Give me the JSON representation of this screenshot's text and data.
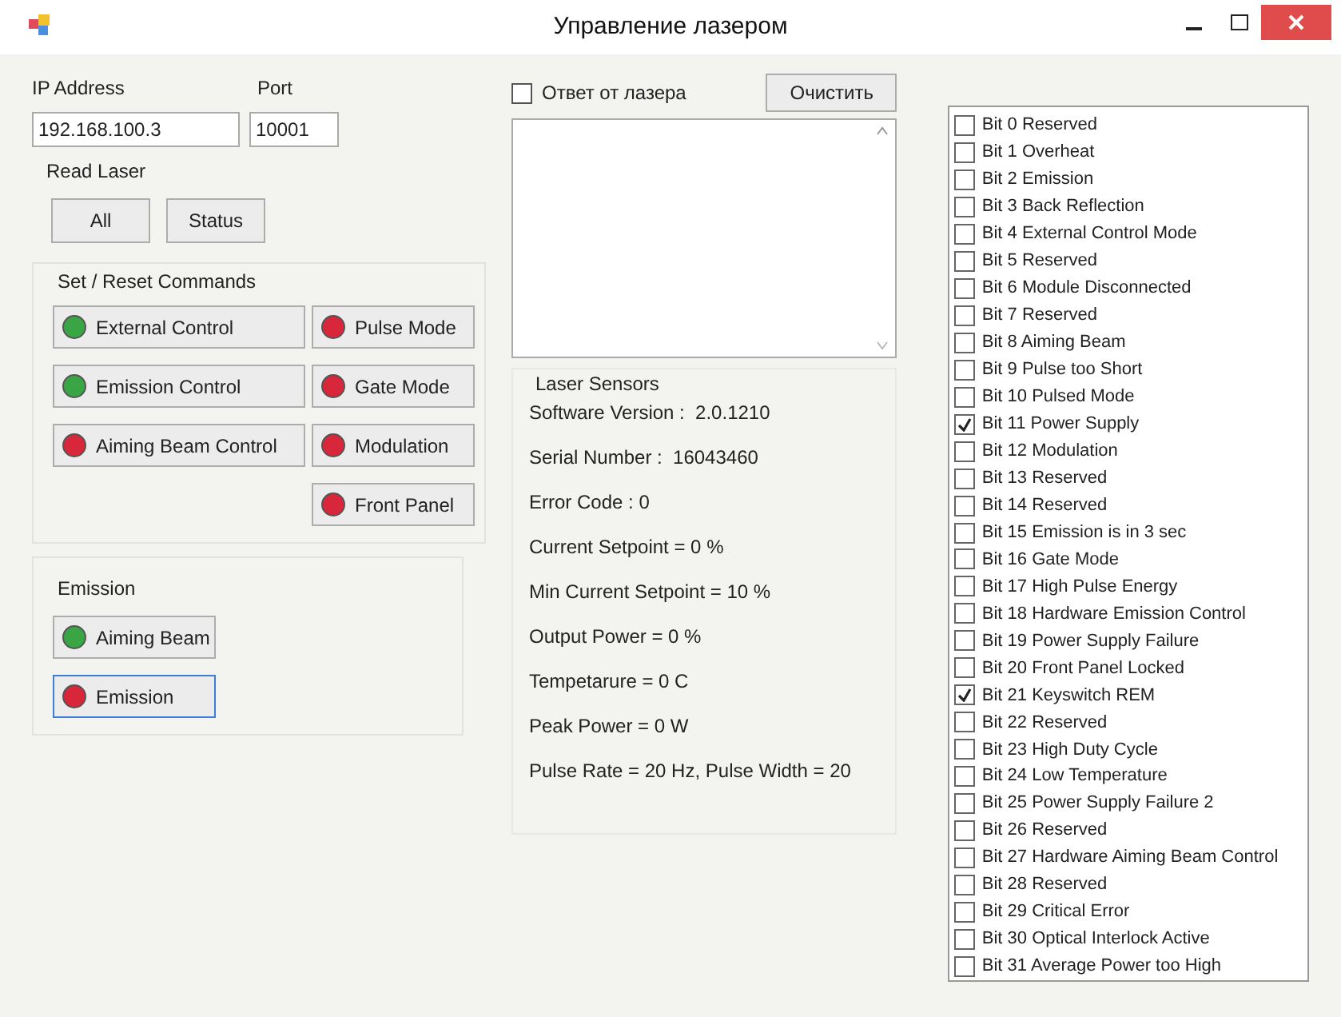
{
  "window": {
    "title": "Управление лазером"
  },
  "connection": {
    "ip_label": "IP Address",
    "ip_value": "192.168.100.3",
    "port_label": "Port",
    "port_value": "10001"
  },
  "read_laser": {
    "title": "Read Laser",
    "buttons": [
      "All",
      "Status"
    ]
  },
  "set_reset": {
    "title": "Set / Reset Commands",
    "left": [
      {
        "label": "External Control",
        "on": true
      },
      {
        "label": "Emission Control",
        "on": true
      },
      {
        "label": "Aiming Beam Control",
        "on": false
      }
    ],
    "right": [
      {
        "label": "Pulse Mode",
        "on": false
      },
      {
        "label": "Gate Mode",
        "on": false
      },
      {
        "label": "Modulation",
        "on": false
      },
      {
        "label": "Front Panel",
        "on": false
      }
    ]
  },
  "emission": {
    "title": "Emission",
    "buttons": [
      {
        "label": "Aiming Beam",
        "on": true,
        "focused": false
      },
      {
        "label": "Emission",
        "on": false,
        "focused": true
      }
    ]
  },
  "response": {
    "label": "Ответ от лазера",
    "checked": false,
    "clear_button": "Очистить"
  },
  "sensors": {
    "title": "Laser Sensors",
    "lines": [
      "Software Version :  2.0.1210",
      "Serial Number :  16043460",
      "Error Code : 0",
      "Current Setpoint = 0 %",
      "Min Current Setpoint = 10 %",
      "Output Power = 0 %",
      "Tempetarure = 0 C",
      "Peak Power = 0 W",
      "Pulse Rate = 20 Hz, Pulse Width = 20"
    ]
  },
  "status_bits": [
    {
      "label": "Bit 0 Reserved",
      "checked": false
    },
    {
      "label": "Bit 1 Overheat",
      "checked": false
    },
    {
      "label": "Bit 2 Emission",
      "checked": false
    },
    {
      "label": "Bit 3 Back Reflection",
      "checked": false
    },
    {
      "label": "Bit 4 External Control Mode",
      "checked": false
    },
    {
      "label": "Bit 5 Reserved",
      "checked": false
    },
    {
      "label": "Bit 6 Module Disconnected",
      "checked": false
    },
    {
      "label": "Bit 7 Reserved",
      "checked": false
    },
    {
      "label": "Bit 8 Aiming Beam",
      "checked": false
    },
    {
      "label": "Bit 9 Pulse too Short",
      "checked": false
    },
    {
      "label": "Bit 10 Pulsed Mode",
      "checked": false
    },
    {
      "label": "Bit 11 Power Supply",
      "checked": true
    },
    {
      "label": "Bit 12 Modulation",
      "checked": false
    },
    {
      "label": "Bit 13 Reserved",
      "checked": false
    },
    {
      "label": "Bit 14 Reserved",
      "checked": false
    },
    {
      "label": "Bit 15 Emission is in 3 sec",
      "checked": false
    },
    {
      "label": "Bit 16 Gate Mode",
      "checked": false
    },
    {
      "label": "Bit 17 High Pulse Energy",
      "checked": false
    },
    {
      "label": "Bit 18 Hardware Emission Control",
      "checked": false
    },
    {
      "label": "Bit 19 Power Supply Failure",
      "checked": false
    },
    {
      "label": "Bit 20 Front Panel Locked",
      "checked": false
    },
    {
      "label": "Bit 21 Keyswitch REM",
      "checked": true
    },
    {
      "label": "Bit 22 Reserved",
      "checked": false
    },
    {
      "label": "Bit 23 High Duty Cycle",
      "checked": false
    },
    {
      "label": "Bit 24 Low Temperature",
      "checked": false
    },
    {
      "label": "Bit 25 Power Supply Failure 2",
      "checked": false
    },
    {
      "label": "Bit 26 Reserved",
      "checked": false
    },
    {
      "label": "Bit 27 Hardware Aiming Beam Control",
      "checked": false
    },
    {
      "label": "Bit 28 Reserved",
      "checked": false
    },
    {
      "label": "Bit 29 Critical Error",
      "checked": false
    },
    {
      "label": "Bit 30 Optical Interlock Active",
      "checked": false
    },
    {
      "label": "Bit 31 Average Power too High",
      "checked": false
    }
  ]
}
